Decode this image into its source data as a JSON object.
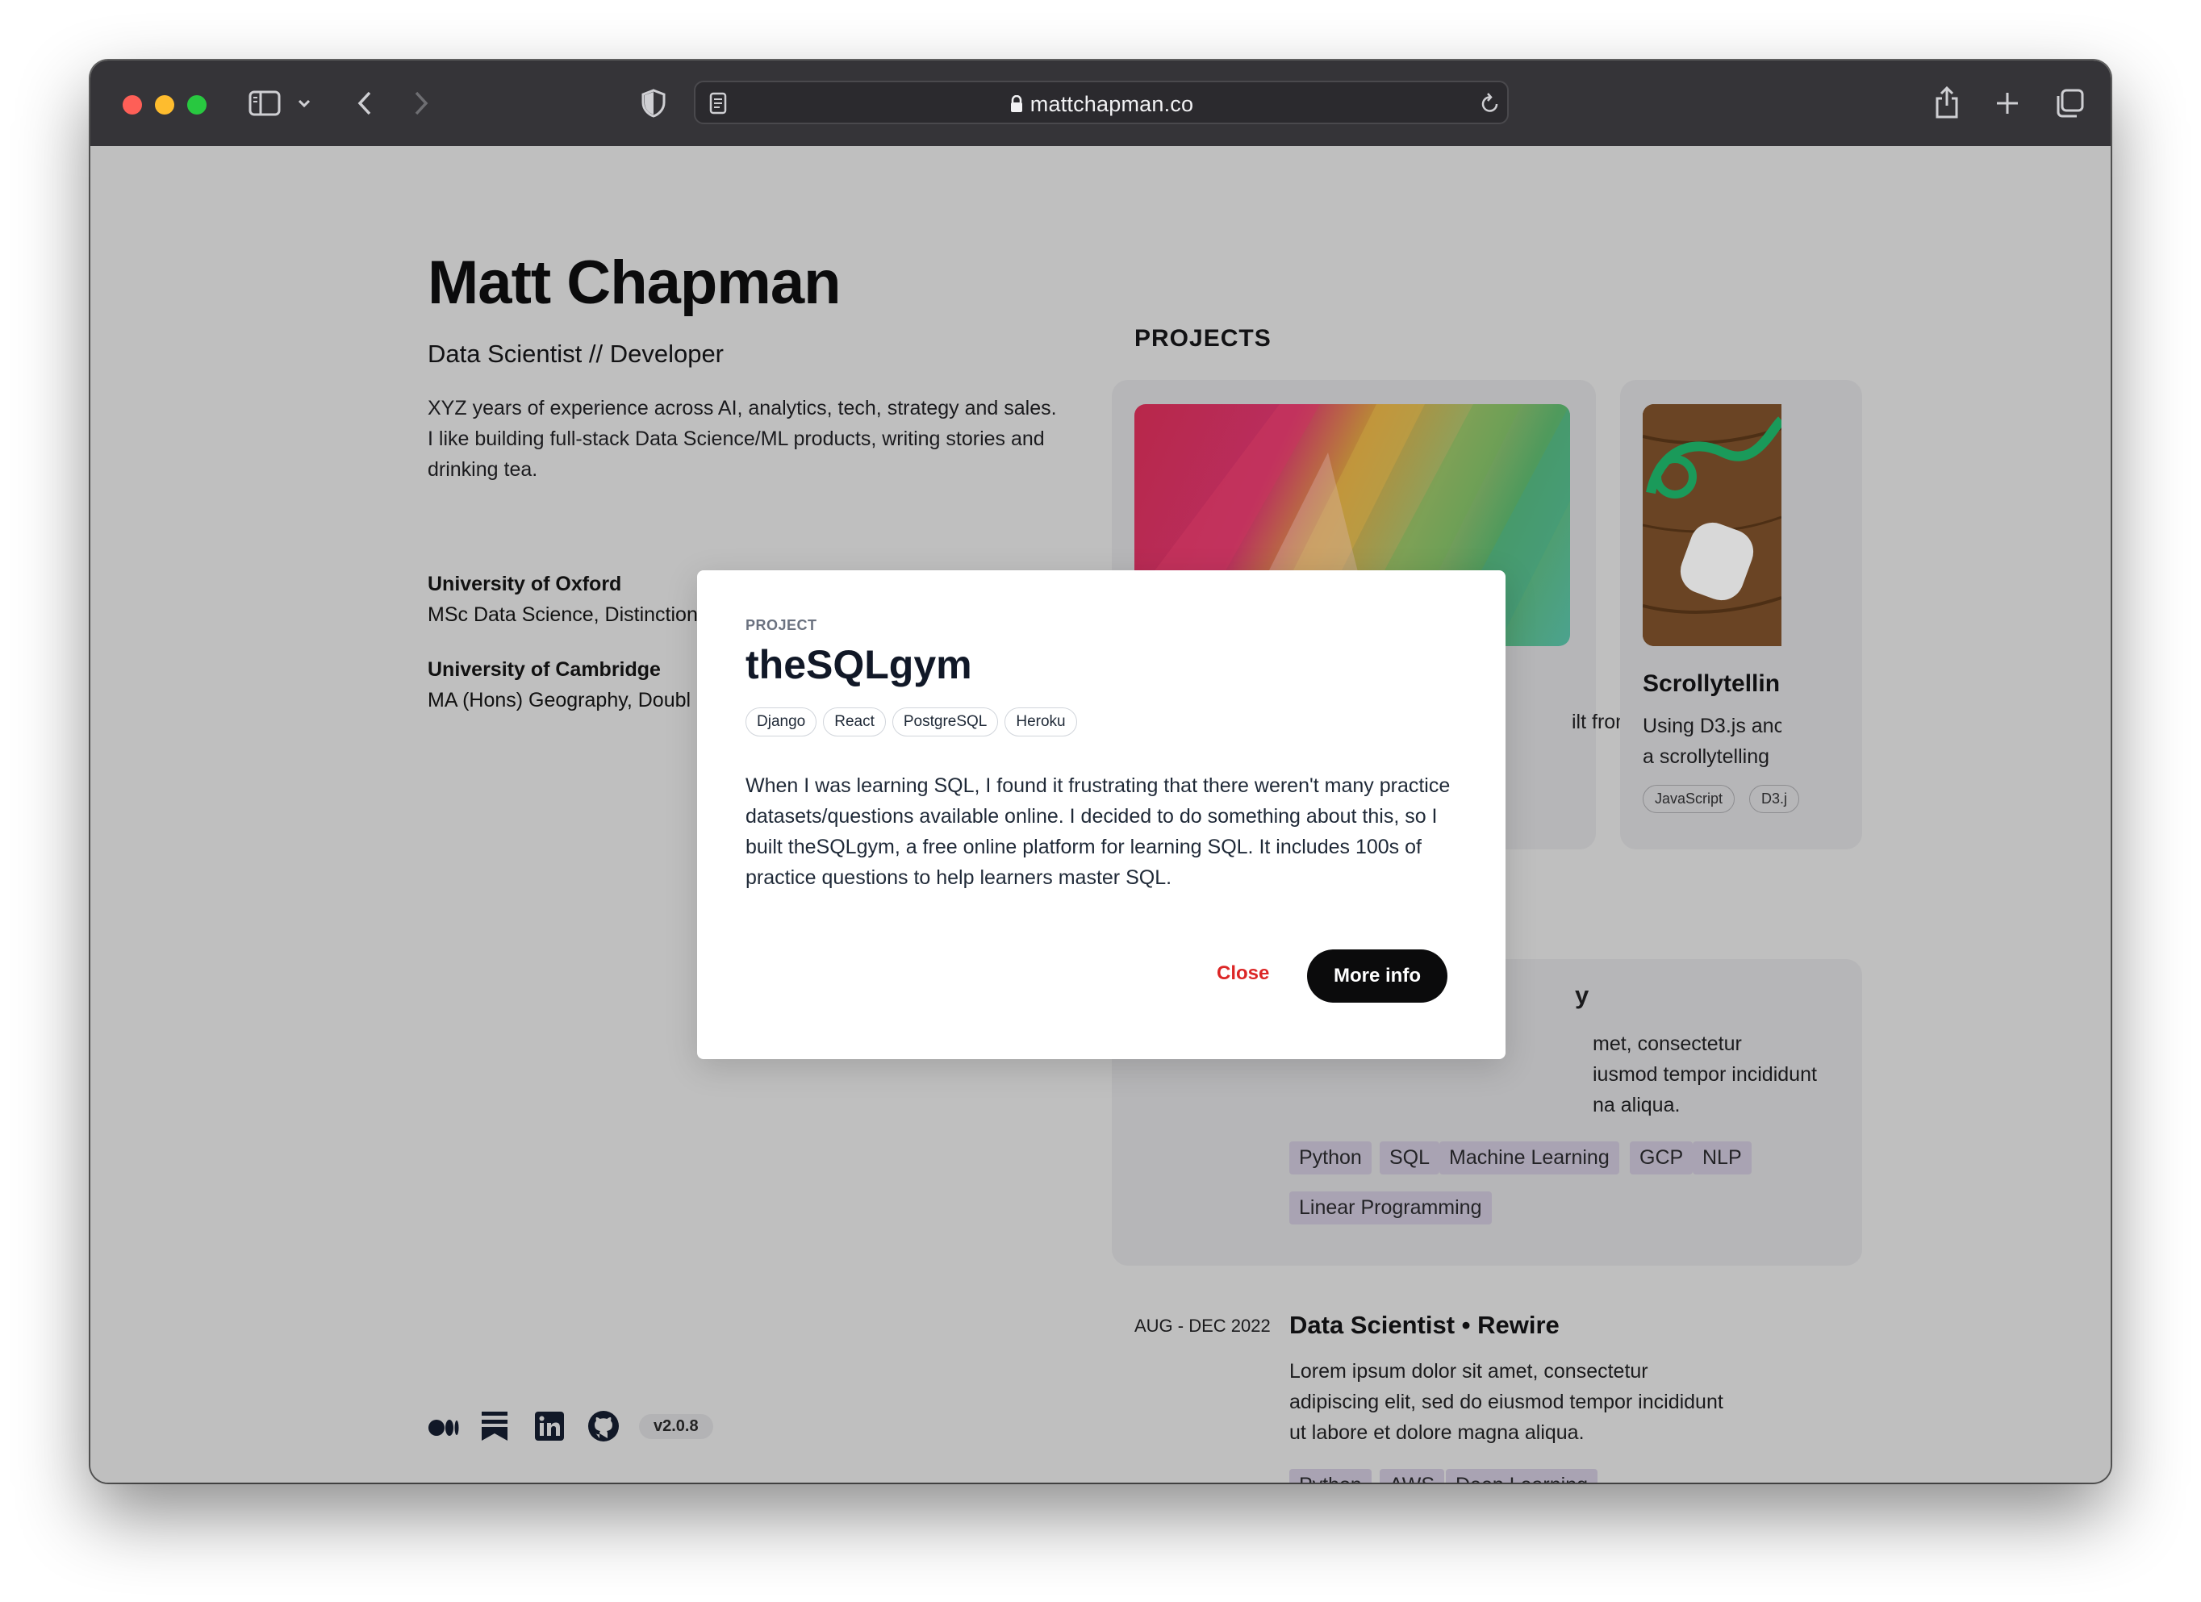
{
  "browser": {
    "url": "mattchapman.co"
  },
  "profile": {
    "name": "Matt Chapman",
    "role": "Data Scientist // Developer",
    "bio": "XYZ years of experience across AI, analytics, tech, strategy and sales. I like building full-stack Data Science/ML products, writing stories and drinking tea.",
    "education": [
      {
        "school": "University of Oxford",
        "degree": "MSc Data Science, Distinction"
      },
      {
        "school": "University of Cambridge",
        "degree": "MA (Hons) Geography, Doubl"
      }
    ],
    "version": "v2.0.8"
  },
  "projects": {
    "heading": "PROJECTS",
    "card1_peek_text": "ilt from",
    "card2": {
      "title": "Scrollytellin",
      "text_line1": "Using D3.js anc",
      "text_line2": "a scrollytelling",
      "tags": [
        "JavaScript",
        "D3.j"
      ]
    }
  },
  "experience": [
    {
      "title_peek": "y",
      "lines": [
        "met, consectetur",
        "iusmod tempor incididunt",
        "na aliqua."
      ],
      "skills": [
        "Python",
        "SQL",
        "Machine Learning",
        "GCP",
        "NLP",
        "Linear Programming"
      ]
    },
    {
      "date": "AUG - DEC 2022",
      "title": "Data Scientist • Rewire",
      "lines": [
        "Lorem ipsum dolor sit amet, consectetur",
        "adipiscing elit, sed do eiusmod tempor incididunt",
        "ut labore et dolore magna aliqua."
      ],
      "skills": [
        "Python",
        "AWS",
        "Deep Learning"
      ]
    }
  ],
  "modal": {
    "kicker": "PROJECT",
    "title": "theSQLgym",
    "tags": [
      "Django",
      "React",
      "PostgreSQL",
      "Heroku"
    ],
    "body": "When I was learning SQL, I found it frustrating that there weren't many practice datasets/questions available online. I decided to do something about this, so I built theSQLgym, a free online platform for learning SQL. It includes 100s of practice questions to help learners master SQL.",
    "close_label": "Close",
    "more_label": "More info"
  }
}
